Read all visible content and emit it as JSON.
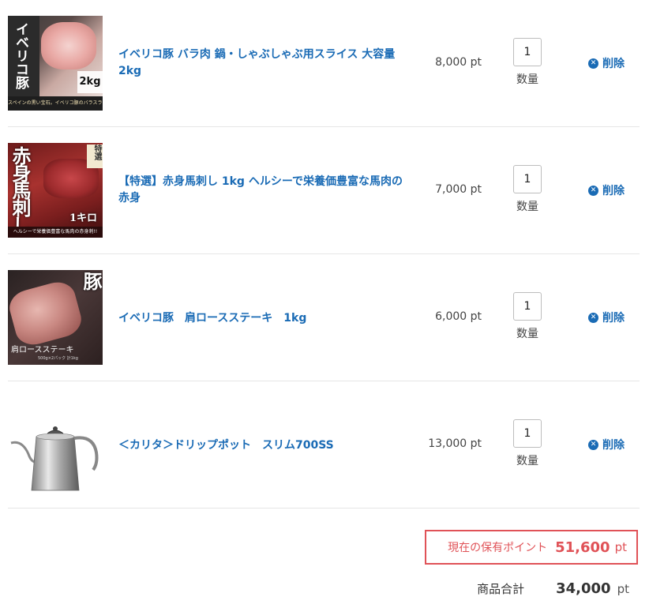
{
  "cart": {
    "items": [
      {
        "title": "イベリコ豚 バラ肉 鍋・しゃぶしゃぶ用スライス 大容量2kg",
        "price": "8,000 pt",
        "quantity": "1",
        "quantity_label": "数量",
        "delete_label": "削除",
        "thumb_text": {
          "main": "イベリコ豚",
          "badge": "2kg",
          "caption": "スペインの黒い宝石。イベリコ豚のバラスライス"
        }
      },
      {
        "title": "【特選】赤身馬刺し 1kg ヘルシーで栄養価豊富な馬肉の赤身",
        "price": "7,000 pt",
        "quantity": "1",
        "quantity_label": "数量",
        "delete_label": "削除",
        "thumb_text": {
          "main": "赤身馬刺し",
          "badge": "特選",
          "size": "1キロ",
          "caption": "ヘルシーで栄養価豊富な馬肉の赤身刺!!"
        }
      },
      {
        "title": "イベリコ豚　肩ロースステーキ　1kg",
        "price": "6,000 pt",
        "quantity": "1",
        "quantity_label": "数量",
        "delete_label": "削除",
        "thumb_text": {
          "main": "イベリコ豚",
          "caption": "肩ロースステーキ",
          "sub": "500g×2パック 計1kg"
        }
      },
      {
        "title": "＜カリタ＞ドリップポット　スリム700SS",
        "price": "13,000 pt",
        "quantity": "1",
        "quantity_label": "数量",
        "delete_label": "削除"
      }
    ]
  },
  "points": {
    "label": "現在の保有ポイント",
    "value": "51,600",
    "unit": "pt"
  },
  "total": {
    "label": "商品合計",
    "value": "34,000",
    "unit": "pt"
  },
  "colors": {
    "link": "#1a6bb5",
    "accent_red": "#e05257"
  },
  "icons": [
    "close-circle-icon"
  ]
}
